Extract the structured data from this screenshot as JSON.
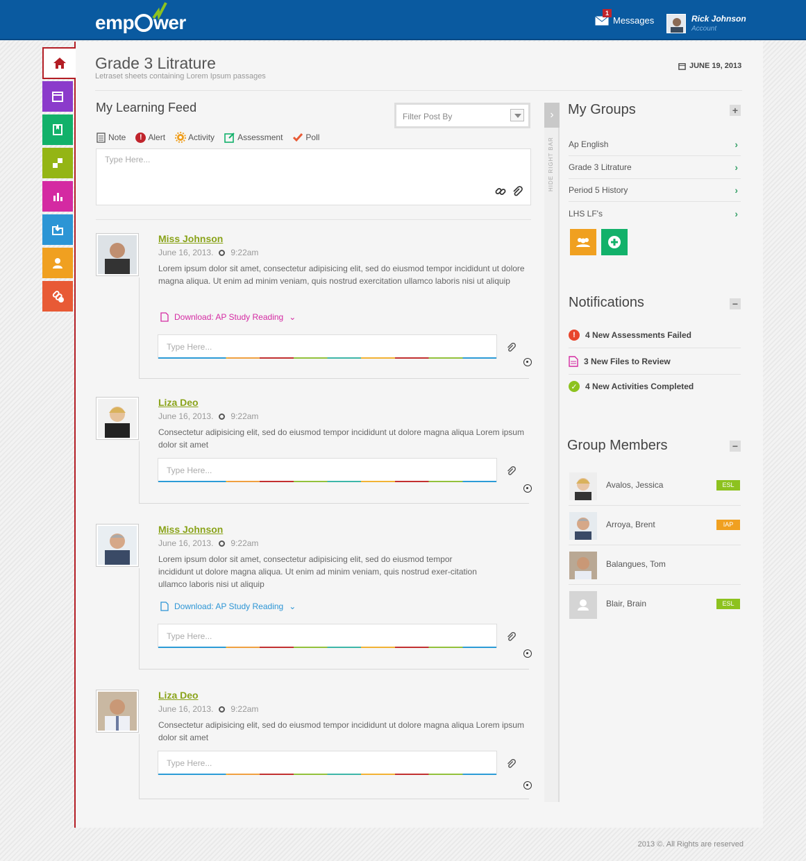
{
  "header": {
    "logo": "empower",
    "messages_label": "Messages",
    "messages_count": "1",
    "user_name": "Rick Johnson",
    "account_label": "Account"
  },
  "nav": {
    "items": [
      "home-icon",
      "calendar-icon",
      "book-icon",
      "grid-icon",
      "chart-icon",
      "folder-icon",
      "people-icon",
      "link-add-icon"
    ],
    "colors": [
      "#ffffff",
      "#8b3bcb",
      "#12b16a",
      "#94b514",
      "#d42aa2",
      "#2c95d5",
      "#f0a020",
      "#e85a35"
    ]
  },
  "page": {
    "title": "Grade 3 Litrature",
    "subtitle": "Letraset sheets containing Lorem Ipsum passages",
    "date": "JUNE 19, 2013"
  },
  "feed": {
    "title": "My Learning Feed",
    "filter_placeholder": "Filter Post By",
    "post_types": [
      "Note",
      "Alert",
      "Activity",
      "Assessment",
      "Poll"
    ],
    "compose_placeholder": "Type Here...",
    "posts": [
      {
        "author": "Miss Johnson",
        "date": "June 16, 2013.",
        "time": "9:22am",
        "body": "Lorem ipsum dolor sit amet, consectetur adipisicing elit, sed do eiusmod tempor incididunt ut dolore magna aliqua. Ut enim ad minim veniam, quis nostrud exercitation ullamco laboris nisi ut aliquip",
        "download": "Download: AP Study Reading",
        "reply_placeholder": "Type Here..."
      },
      {
        "author": "Liza Deo",
        "date": "June 16, 2013.",
        "time": "9:22am",
        "body": "Consectetur adipisicing elit, sed do eiusmod tempor incididunt ut dolore magna aliqua Lorem ipsum dolor sit amet",
        "reply_placeholder": "Type Here..."
      },
      {
        "author": "Miss Johnson",
        "date": "June 16, 2013.",
        "time": "9:22am",
        "body": "Lorem ipsum dolor sit amet, consectetur adipisicing elit, sed do eiusmod tempor incididunt ut dolore magna aliqua. Ut enim ad minim veniam, quis nostrud exer-citation ullamco laboris nisi ut aliquip",
        "download": "Download: AP Study Reading",
        "reply_placeholder": "Type Here..."
      },
      {
        "author": "Liza Deo",
        "date": "June 16, 2013.",
        "time": "9:22am",
        "body": "Consectetur adipisicing elit, sed do eiusmod tempor incididunt ut dolore magna aliqua Lorem ipsum dolor sit amet",
        "reply_placeholder": "Type Here..."
      }
    ]
  },
  "sidebar": {
    "hide_label": "HIDE RIGHT BAR",
    "groups_title": "My Groups",
    "groups": [
      "Ap English",
      "Grade 3 Litrature",
      "Period 5 History",
      "LHS LF's"
    ],
    "notifications_title": "Notifications",
    "notifications": [
      {
        "text": "4 New Assessments Failed",
        "icon": "alert-icon",
        "color": "#e8452c"
      },
      {
        "text": "3 New Files to Review",
        "icon": "file-icon",
        "color": "#d42aa2"
      },
      {
        "text": "4 New Activities Completed",
        "icon": "check-icon",
        "color": "#8dc21f"
      }
    ],
    "members_title": "Group Members",
    "members": [
      {
        "name": "Avalos, Jessica",
        "tag": "ESL",
        "tag_color": "#8dc21f"
      },
      {
        "name": "Arroya, Brent",
        "tag": "IAP",
        "tag_color": "#f0a020"
      },
      {
        "name": "Balangues, Tom",
        "tag": "",
        "tag_color": ""
      },
      {
        "name": "Blair, Brain",
        "tag": "ESL",
        "tag_color": "#8dc21f"
      }
    ]
  },
  "footer": {
    "copyright": "2013 ©. All Rights are reserved"
  }
}
